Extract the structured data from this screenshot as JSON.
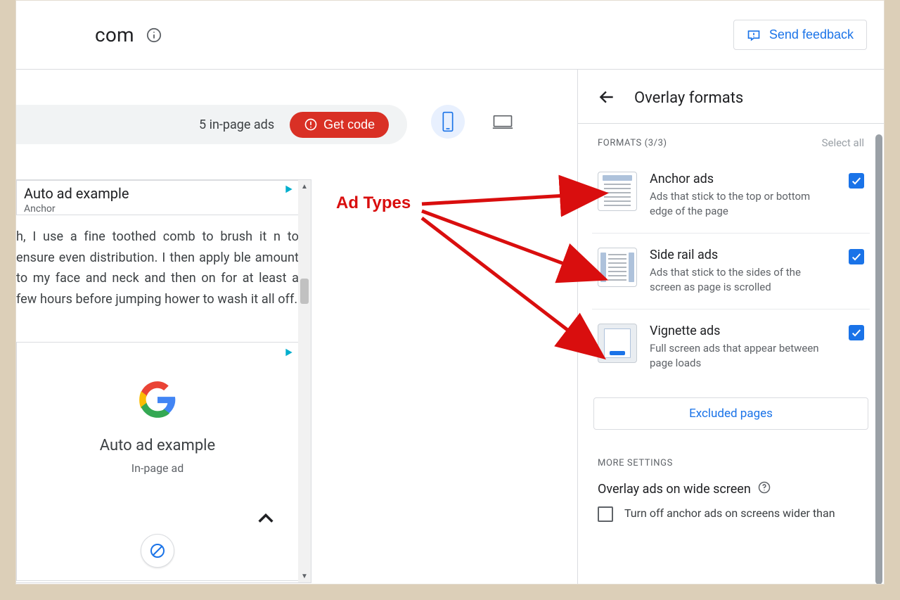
{
  "header": {
    "site_domain": "com",
    "feedback_label": "Send feedback"
  },
  "toolbar": {
    "ads_count_label": "5 in-page ads",
    "get_code_label": "Get code"
  },
  "preview": {
    "anchor_ad_title": "Auto ad example",
    "anchor_ad_sub": "Anchor",
    "body_text": "h, I use a fine toothed comb to brush it n to ensure even distribution. I then apply ble amount to my face and neck and then on for at least a few hours before jumping hower to wash it all off.",
    "inpage_title": "Auto ad example",
    "inpage_sub": "In-page ad"
  },
  "panel": {
    "title": "Overlay formats",
    "formats_label": "FORMATS (3/3)",
    "select_all_label": "Select all",
    "formats": [
      {
        "title": "Anchor ads",
        "desc": "Ads that stick to the top or bottom edge of the page",
        "checked": true
      },
      {
        "title": "Side rail ads",
        "desc": "Ads that stick to the sides of the screen as page is scrolled",
        "checked": true
      },
      {
        "title": "Vignette ads",
        "desc": "Full screen ads that appear between page loads",
        "checked": true
      }
    ],
    "excluded_pages_label": "Excluded pages",
    "more_settings_label": "MORE SETTINGS",
    "wide_title": "Overlay ads on wide screen",
    "wide_checkbox_label": "Turn off anchor ads on screens wider than"
  },
  "annotation": {
    "label": "Ad Types"
  }
}
